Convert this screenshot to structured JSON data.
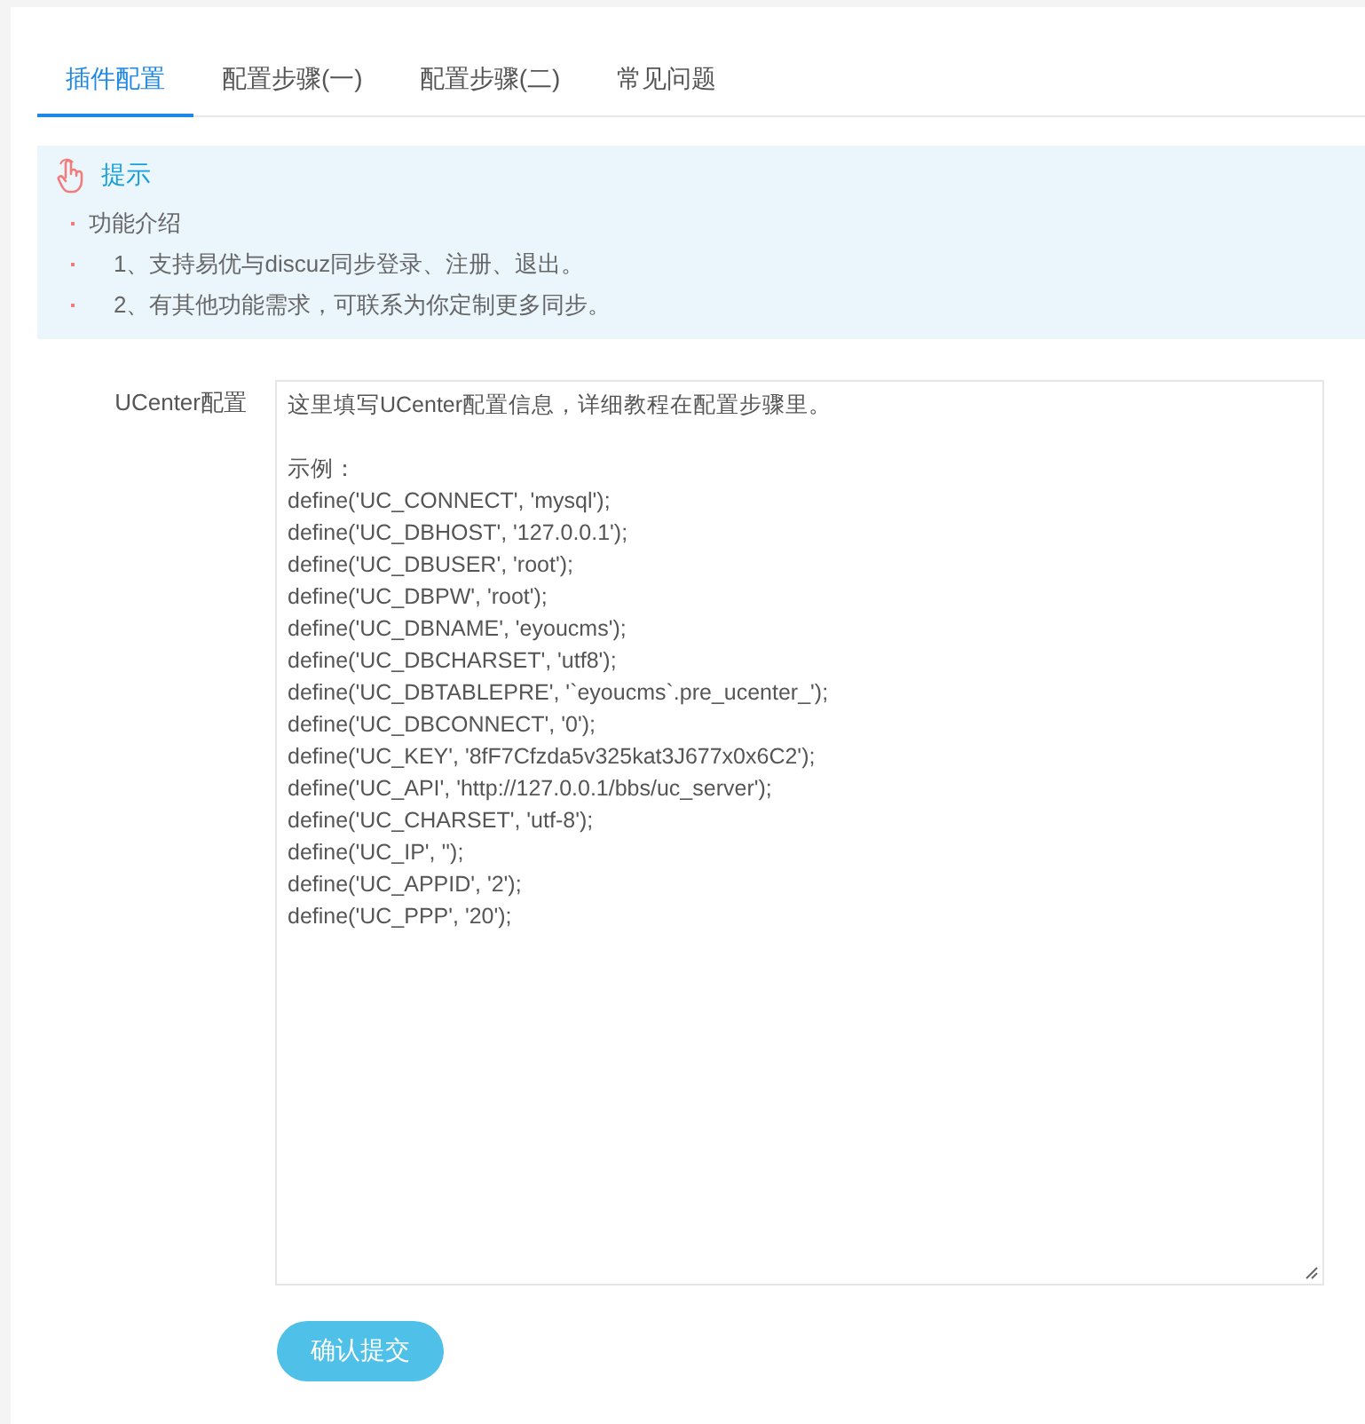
{
  "tabs": [
    {
      "label": "插件配置",
      "selected": true
    },
    {
      "label": "配置步骤(一)",
      "selected": false
    },
    {
      "label": "配置步骤(二)",
      "selected": false
    },
    {
      "label": "常见问题",
      "selected": false
    }
  ],
  "tip": {
    "title": "提示",
    "items": [
      "功能介绍",
      "1、支持易优与discuz同步登录、注册、退出。",
      "2、有其他功能需求，可联系为你定制更多同步。"
    ]
  },
  "form": {
    "label": "UCenter配置",
    "intro": "这里填写UCenter配置信息，详细教程在配置步骤里。",
    "example_label": "示例：",
    "code_lines": [
      "define('UC_CONNECT', 'mysql');",
      "define('UC_DBHOST', '127.0.0.1');",
      "define('UC_DBUSER', 'root');",
      "define('UC_DBPW', 'root');",
      "define('UC_DBNAME', 'eyoucms');",
      "define('UC_DBCHARSET', 'utf8');",
      "define('UC_DBTABLEPRE', '`eyoucms`.pre_ucenter_');",
      "define('UC_DBCONNECT', '0');",
      "define('UC_KEY', '8fF7Cfzda5v325kat3J677x0x6C2');",
      "define('UC_API', 'http://127.0.0.1/bbs/uc_server');",
      "define('UC_CHARSET', 'utf-8');",
      "define('UC_IP', '');",
      "define('UC_APPID', '2');",
      "define('UC_PPP', '20');"
    ]
  },
  "submit": "确认提交"
}
